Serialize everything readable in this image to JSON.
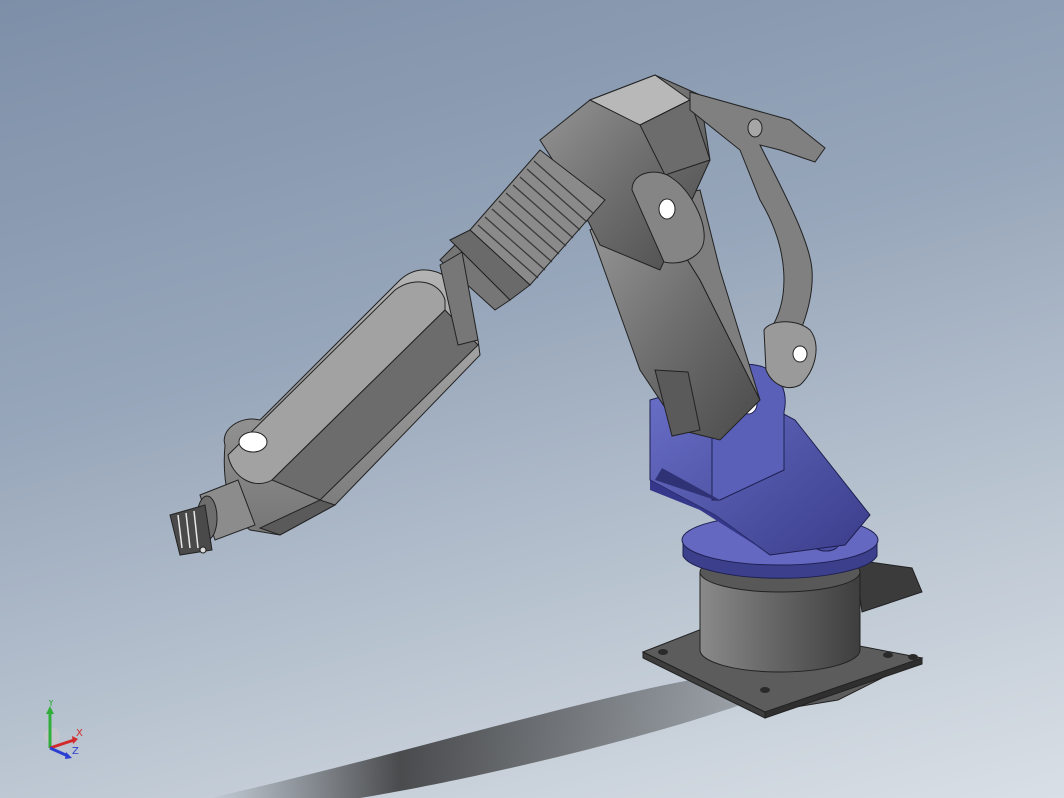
{
  "viewport": {
    "background_top": "#7d8fa8",
    "background_bottom": "#d9dfe6"
  },
  "model": {
    "part_color_gray": "#6e6e6e",
    "part_color_blue": "#4b4fa0",
    "parts": [
      "base-plate",
      "base-cylinder",
      "turntable",
      "shoulder-bracket",
      "upper-arm",
      "elbow-housing",
      "threaded-sleeve",
      "forearm",
      "wrist",
      "gripper",
      "linkage-rod"
    ]
  },
  "triad": {
    "x_label": "X",
    "y_label": "Y",
    "z_label": "Z",
    "x_color": "#d22a2a",
    "y_color": "#2fae3a",
    "z_color": "#2a3ed2"
  }
}
